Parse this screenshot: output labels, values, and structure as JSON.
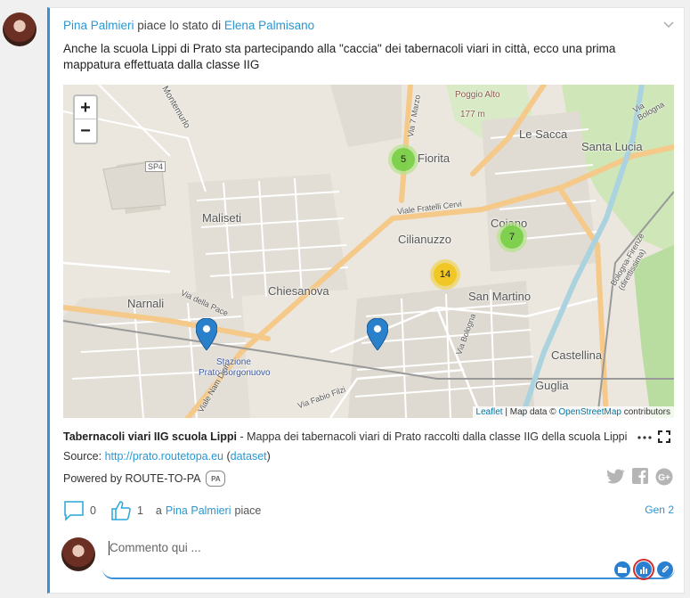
{
  "post": {
    "liker": "Pina Palmieri",
    "likes_text": "piace lo stato di",
    "author": "Elena Palmisano",
    "text": "Anche la scuola Lippi di Prato sta partecipando alla \"caccia\" dei tabernacoli viari in città, ecco una prima mappatura effettuata dalla classe IIG"
  },
  "map": {
    "zoom_in": "+",
    "zoom_out": "−",
    "labels": [
      "Montemurlo",
      "Poggio Alto",
      "177 m",
      "Via 7 Marzo",
      "Le Sacca",
      "Santa Lucia",
      "SP4",
      "Fiorita",
      "Maliseti",
      "Viale Fratelli Cervi",
      "Cilianuzzo",
      "Coiano",
      "Narnali",
      "Chiesanova",
      "Via della Pace",
      "San Martino",
      "Castellina",
      "Stazione",
      "Prato Borgonuovo",
      "Guglia",
      "Via Bologna",
      "Via Fabio Filzi",
      "Viale Nam Dinh",
      "Bologna-Firenze (direttissima)",
      "Via Bologna"
    ],
    "clusters": [
      {
        "count": "5",
        "color": "green"
      },
      {
        "count": "7",
        "color": "green"
      },
      {
        "count": "14",
        "color": "yellow"
      }
    ],
    "attribution": {
      "leaflet": "Leaflet",
      "text": "| Map data ©",
      "osm": "OpenStreetMap",
      "contributors": "contributors"
    }
  },
  "caption": {
    "title": "Tabernacoli viari IIG scuola Lippi",
    "description": "- Mappa dei tabernacoli viari di Prato raccolti dalla classe IIG della scuola Lippi"
  },
  "source": {
    "label": "Source:",
    "url": "http://prato.routetopa.eu",
    "dataset": "dataset"
  },
  "powered": {
    "text": "Powered by ROUTE-TO-PA",
    "logo": "PA"
  },
  "actions": {
    "comments_count": "0",
    "likes_count": "1",
    "liked_by_prefix": "a",
    "liked_by": "Pina Palmieri",
    "liked_by_suffix": "piace",
    "date": "Gen 2"
  },
  "comment": {
    "placeholder": "Commento qui ..."
  },
  "colors": {
    "accent": "#3a8fd6",
    "link": "#2a97d2",
    "highlight": "#d62b2b"
  }
}
